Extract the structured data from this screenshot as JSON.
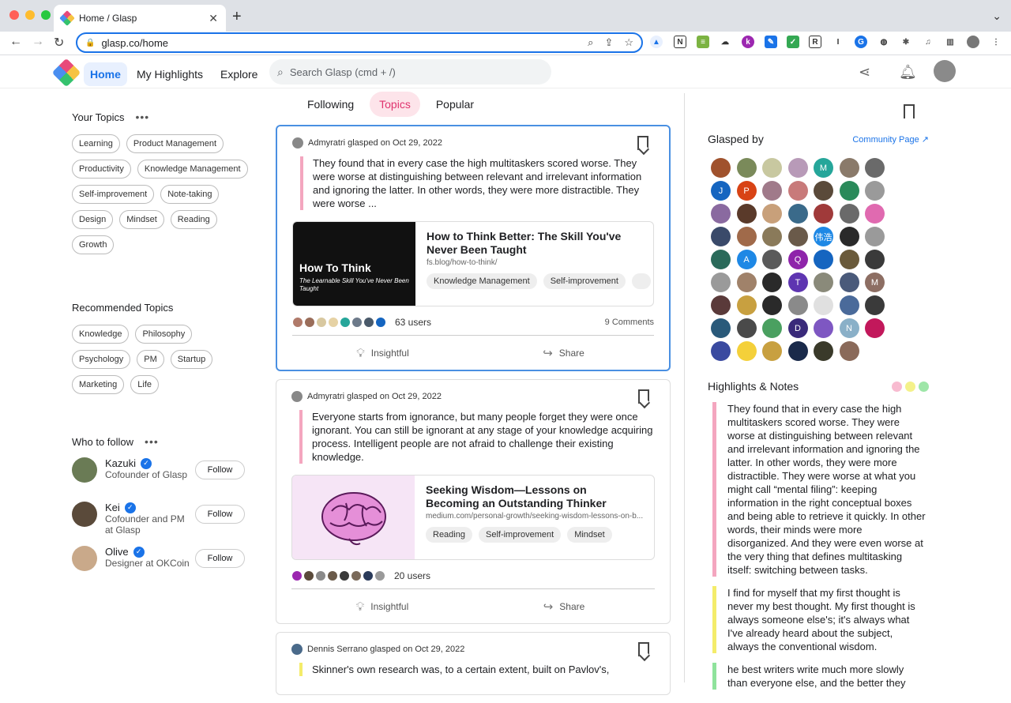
{
  "browser": {
    "tab_title": "Home / Glasp",
    "url": "glasp.co/home",
    "traffic_colors": [
      "#ff5f57",
      "#febc2e",
      "#28c840"
    ]
  },
  "header": {
    "nav": [
      "Home",
      "My Highlights",
      "Explore"
    ],
    "search_placeholder": "Search Glasp (cmd + /)"
  },
  "left": {
    "your_topics_title": "Your Topics",
    "your_topics": [
      "Learning",
      "Product Management",
      "Productivity",
      "Knowledge Management",
      "Self-improvement",
      "Note-taking",
      "Design",
      "Mindset",
      "Reading",
      "Growth"
    ],
    "recommended_title": "Recommended Topics",
    "recommended": [
      "Knowledge",
      "Philosophy",
      "Psychology",
      "PM",
      "Startup",
      "Marketing",
      "Life"
    ],
    "who_title": "Who to follow",
    "follow_label": "Follow",
    "people": [
      {
        "name": "Kazuki",
        "desc": "Cofounder of Glasp",
        "color": "#6a7b55"
      },
      {
        "name": "Kei",
        "desc": "Cofounder and PM at Glasp",
        "color": "#5a4a3a"
      },
      {
        "name": "Olive",
        "desc": "Designer at OKCoin",
        "color": "#c9a98a"
      }
    ]
  },
  "feed": {
    "tabs": [
      "Following",
      "Topics",
      "Popular"
    ],
    "insightful": "Insightful",
    "share": "Share",
    "cards": [
      {
        "author": "Admyratri",
        "action": "glasped on Oct 29, 2022",
        "quote": "They found that in every case the high multitaskers scored worse. They were worse at distinguishing between relevant and irrelevant information and ignoring the latter. In other words, they were more distractible. They were worse ...",
        "title": "How to Think Better: The Skill You've Never Been Taught",
        "url": "fs.blog/how-to-think/",
        "tags": [
          "Knowledge Management",
          "Self-improvement"
        ],
        "thumb_t1": "How To Think",
        "thumb_t2": "The Learnable Skill You've Never Been Taught",
        "users": "63 users",
        "comments": "9 Comments"
      },
      {
        "author": "Admyratri",
        "action": "glasped on Oct 29, 2022",
        "quote": "Everyone starts from ignorance, but many people forget they were once ignorant. You can still be ignorant at any stage of your knowledge acquiring process. Intelligent people are not afraid to challenge their existing knowledge.",
        "title": "Seeking Wisdom—Lessons on Becoming an Outstanding Thinker",
        "url": "medium.com/personal-growth/seeking-wisdom-lessons-on-b...",
        "tags": [
          "Reading",
          "Self-improvement",
          "Mindset"
        ],
        "users": "20 users"
      },
      {
        "author": "Dennis Serrano",
        "action": "glasped on Oct 29, 2022",
        "quote": "Skinner's own research was, to a certain extent, built on Pavlov's,"
      }
    ]
  },
  "right": {
    "glasped_by": "Glasped by",
    "community": "Community Page ↗",
    "avatar_letters": [
      "",
      "",
      "",
      "",
      "M",
      "",
      "",
      "J",
      "P",
      "",
      "",
      "",
      "",
      "",
      "",
      "",
      "",
      "",
      "",
      "",
      "",
      "",
      "",
      "",
      "",
      "伟浩",
      "",
      "",
      "",
      "A",
      "",
      "Q",
      "",
      "",
      "",
      "",
      "",
      "",
      "T",
      "",
      "",
      "M",
      "",
      "",
      "",
      "",
      "",
      "",
      "",
      "",
      "",
      "",
      "D",
      "",
      "N",
      "",
      "",
      "",
      "",
      "",
      "",
      ""
    ],
    "highlights_title": "Highlights & Notes",
    "dot_colors": [
      "#f8bbd0",
      "#f4f18a",
      "#9ee6a8"
    ],
    "highlights": [
      {
        "color": "#f4a6bf",
        "text": "They found that in every case the high multitaskers scored worse. They were worse at distinguishing between relevant and irrelevant information and ignoring the latter. In other words, they were more distractible. They were worse at what you might call “mental filing”: keeping information in the right conceptual boxes and being able to retrieve it quickly. In other words, their minds were more disorganized. And they were even worse at the very thing that defines multitasking itself: switching between tasks."
      },
      {
        "color": "#f4ec6a",
        "text": "I find for myself that my first thought is never my best thought. My first thought is always someone else's; it's always what I've already heard about the subject, always the conventional wisdom."
      },
      {
        "color": "#8fe39c",
        "text": "he best writers write much more slowly than everyone else, and the better they"
      }
    ]
  }
}
